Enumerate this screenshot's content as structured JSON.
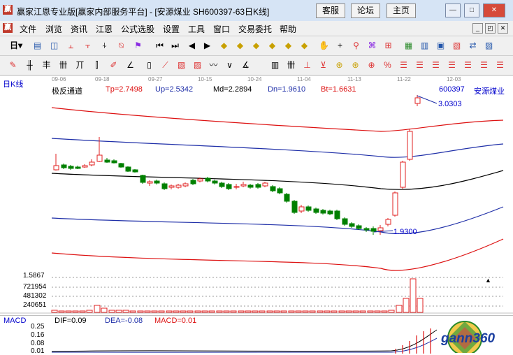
{
  "window": {
    "logo_text": "赢",
    "title": "赢家江恩专业版[赢家内部服务平台] - [安源煤业  SH600397-63日K线]",
    "links": [
      "客服",
      "论坛",
      "主页"
    ]
  },
  "menu": [
    "文件",
    "浏览",
    "资讯",
    "江恩",
    "公式选股",
    "设置",
    "工具",
    "窗口",
    "交易委托",
    "帮助"
  ],
  "toolbar1": {
    "period_label": "日",
    "icons": [
      "book-icon",
      "candle-chart-icon",
      "kline-up-icon",
      "kline-down-icon",
      "bar-icon",
      "pattern-icon",
      "flag-icon",
      "first-icon",
      "last-icon",
      "prev-icon",
      "next-icon",
      "diamond-up-icon",
      "diamond-down-icon",
      "diamond-left-icon",
      "diamond-right-icon",
      "diamond-upleft-icon",
      "diamond-all-icon",
      "hand-icon",
      "crosshair-icon",
      "zoom-icon",
      "gift-icon",
      "calendar-icon",
      "table-icon",
      "report-icon",
      "save-icon",
      "copy-icon",
      "transfer-icon"
    ]
  },
  "toolbar2": {
    "icons": [
      "draw-pen-icon",
      "grid-icon",
      "tri-icon",
      "fan-icon",
      "gann-icon",
      "arc-icon",
      "box-icon",
      "angle-icon",
      "rect-icon",
      "wave-icon",
      "line-icon",
      "v-line-icon",
      "h-line-icon",
      "chart1-icon",
      "chart2-icon",
      "chart3-icon",
      "circle1-icon",
      "circle2-icon",
      "rise-icon",
      "down-icon",
      "split-icon",
      "wave-split-icon",
      "percent-icon",
      "h-split-icon"
    ]
  },
  "chart": {
    "period_label": "日K线",
    "indicator_name": "极反通道",
    "tp": "Tp=2.7498",
    "up": "Up=2.5342",
    "md": "Md=2.2894",
    "dn": "Dn=1.9610",
    "bt": "Bt=1.6631",
    "stock_code": "600397",
    "stock_name": "安源煤业",
    "high_label": "3.0303",
    "low_label": "1.9300",
    "date_labels": [
      "09-06",
      "09-18",
      "09-27",
      "10-15",
      "10-24",
      "11-04",
      "11-13",
      "11-22",
      "12-03"
    ],
    "volume_labels": [
      "1.5867",
      "721954",
      "481302",
      "240651"
    ]
  },
  "macd": {
    "name": "MACD",
    "dif": "DIF=0.09",
    "dea": "DEA=-0.08",
    "macd": "MACD=0.01",
    "axis": [
      "0.25",
      "0.16",
      "0.08",
      "0.01"
    ]
  },
  "watermark": {
    "text": "gann360"
  },
  "colors": {
    "up": "#e02020",
    "down": "#008000",
    "channel_outer": "#d11",
    "channel_upper": "#1f2fa8",
    "channel_mid": "#000000",
    "accent": "#0000cc"
  }
}
